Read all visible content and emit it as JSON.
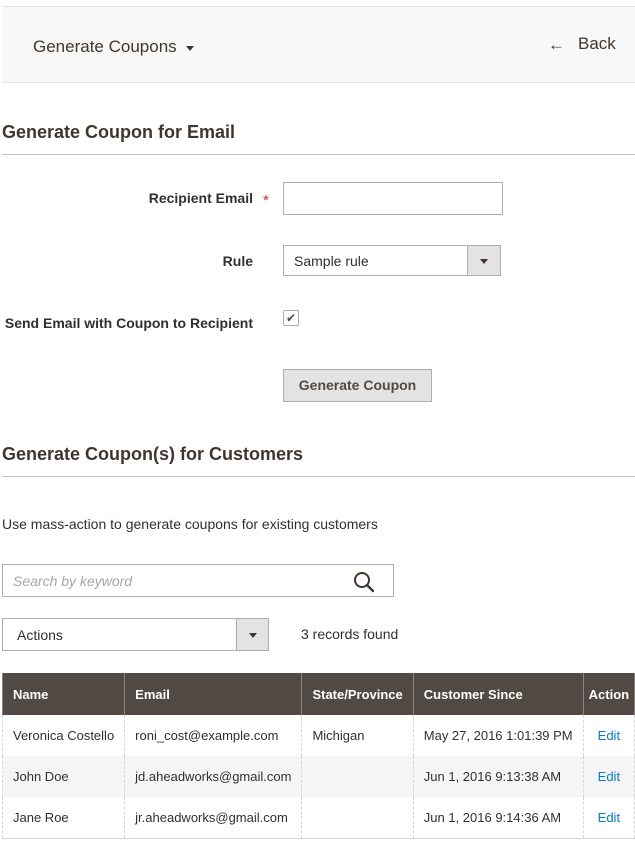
{
  "header": {
    "switcher_label": "Generate Coupons",
    "switcher_icon": "caret-down-icon",
    "back_label": "Back",
    "back_icon": "arrow-left-icon"
  },
  "email_section": {
    "title": "Generate Coupon for Email",
    "recipient_label": "Recipient Email",
    "required_mark": "*",
    "recipient_value": "",
    "rule_label": "Rule",
    "rule_value": "Sample rule",
    "send_email_label": "Send Email with Coupon to Recipient",
    "send_email_checked": true,
    "generate_button": "Generate Coupon"
  },
  "customers_section": {
    "title": "Generate Coupon(s) for Customers",
    "note": "Use mass-action to generate coupons for existing customers",
    "search_placeholder": "Search by keyword",
    "actions_label": "Actions",
    "records_found": "3 records found",
    "columns": [
      "Name",
      "Email",
      "State/Province",
      "Customer Since",
      "Action"
    ],
    "rows": [
      {
        "name": "Veronica Costello",
        "email": "roni_cost@example.com",
        "state": "Michigan",
        "since": "May 27, 2016 1:01:39 PM",
        "action": "Edit"
      },
      {
        "name": "John Doe",
        "email": "jd.aheadworks@gmail.com",
        "state": "",
        "since": "Jun 1, 2016 9:13:38 AM",
        "action": "Edit"
      },
      {
        "name": "Jane Roe",
        "email": "jr.aheadworks@gmail.com",
        "state": "",
        "since": "Jun 1, 2016 9:14:36 AM",
        "action": "Edit"
      }
    ]
  },
  "colors": {
    "header_bg": "#514943",
    "link": "#007bdb",
    "required": "#e22626"
  }
}
